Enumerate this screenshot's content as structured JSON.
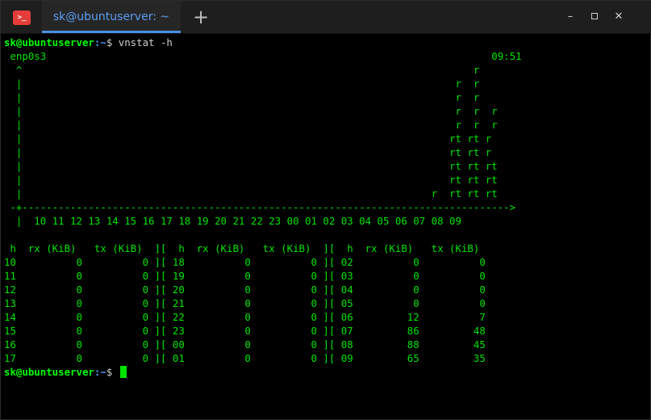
{
  "titlebar": {
    "tab_title": "sk@ubuntuserver: ~",
    "app_icon_text": ">_",
    "new_tab_glyph": "+",
    "minimize_glyph": "–",
    "close_glyph": "✕"
  },
  "prompt": {
    "user_host": "sk@ubuntuserver",
    "path": ":~",
    "symbol": "$",
    "command": " vnstat -h"
  },
  "graph_lines": [
    " enp0s3                                                                          09:51",
    "  ^                                                                           r",
    "  |                                                                        r  r",
    "  |                                                                        r  r",
    "  |                                                                        r  r  r",
    "  |                                                                        r  r  r",
    "  |                                                                       rt rt r",
    "  |                                                                       rt rt r",
    "  |                                                                       rt rt rt",
    "  |                                                                       rt rt rt",
    "  |                                                                    r  rt rt rt",
    " -+--------------------------------------------------------------------------------->",
    "  |  10 11 12 13 14 15 16 17 18 19 20 21 22 23 00 01 02 03 04 05 06 07 08 09",
    ""
  ],
  "table_header": " h  rx (KiB)   tx (KiB)  ][  h  rx (KiB)   tx (KiB)  ][  h  rx (KiB)   tx (KiB)",
  "table_rows": [
    "10          0          0 ][ 18          0          0 ][ 02          0          0",
    "11          0          0 ][ 19          0          0 ][ 03          0          0",
    "12          0          0 ][ 20          0          0 ][ 04          0          0",
    "13          0          0 ][ 21          0          0 ][ 05          0          0",
    "14          0          0 ][ 22          0          0 ][ 06         12          7",
    "15          0          0 ][ 23          0          0 ][ 07         86         48",
    "16          0          0 ][ 00          0          0 ][ 08         88         45",
    "17          0          0 ][ 01          0          0 ][ 09         65         35"
  ],
  "colors": {
    "terminal_text": "#00e400",
    "prompt_user": "#00ff00",
    "prompt_path": "#4f9cff",
    "tab_accent": "#4a90e2",
    "app_icon": "#e53d3a"
  }
}
